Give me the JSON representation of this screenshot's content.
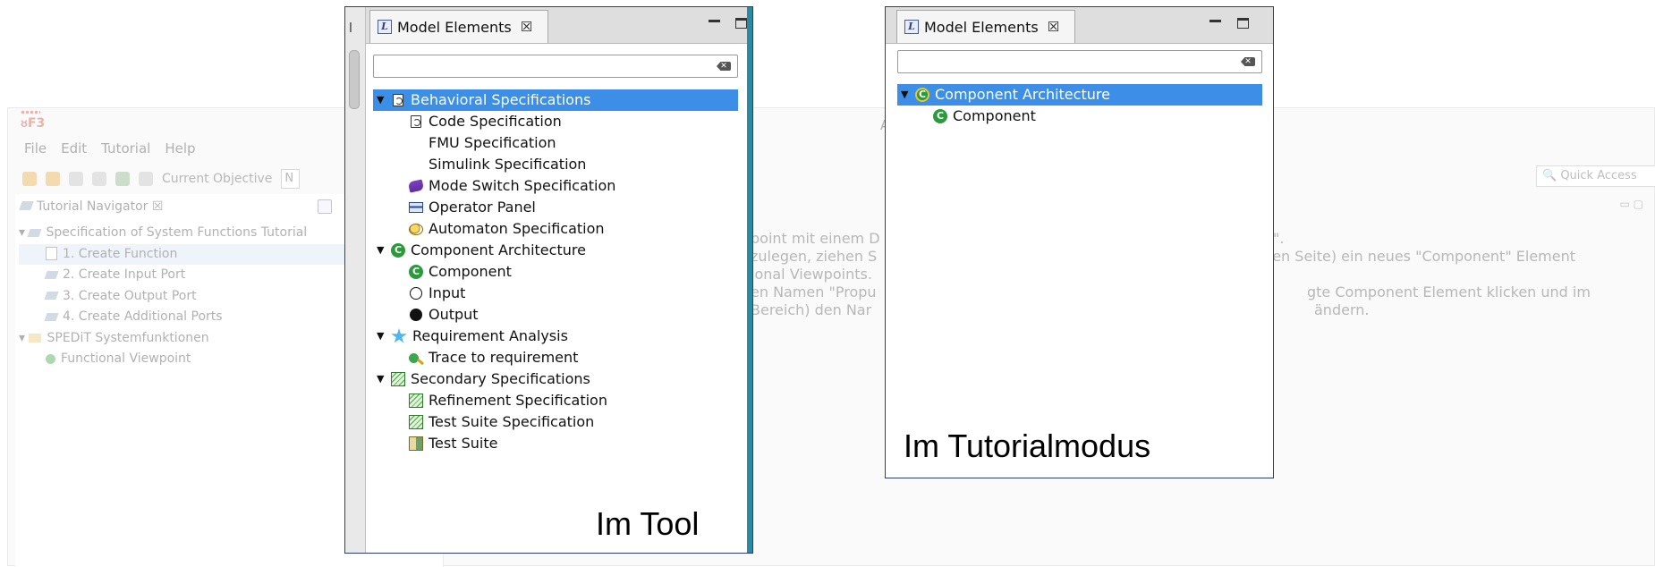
{
  "background_ide": {
    "app_logo": "ᴕF3",
    "window_title": "A",
    "menu": [
      "File",
      "Edit",
      "Tutorial",
      "Help"
    ],
    "current_objective_label": "Current Objective",
    "current_objective_value": "N",
    "quick_access_placeholder": "Quick Access",
    "navigator": {
      "tab_label": "Tutorial Navigator",
      "items": [
        {
          "label": "Specification of System Functions Tutorial",
          "level": 0
        },
        {
          "label": "1. Create Function",
          "level": 1,
          "selected": true
        },
        {
          "label": "2. Create Input Port",
          "level": 1
        },
        {
          "label": "3. Create Output Port",
          "level": 1
        },
        {
          "label": "4. Create Additional Ports",
          "level": 1
        },
        {
          "label": "SPEDiT Systemfunktionen",
          "level": 0
        },
        {
          "label": "Functional Viewpoint",
          "level": 1
        }
      ]
    },
    "instruction_fragments": [
      "point mit einem D",
      "zulegen, ziehen S",
      "ional Viewpoints.",
      "en Namen \"Propu",
      "Bereich) den Nar"
    ],
    "instruction_fragments_right": [
      "\".",
      "chten Seite) ein neues \"Component\" Element",
      "",
      "gte Component Element klicken und im",
      "ändern."
    ]
  },
  "panel_tool": {
    "tab_label": "Model Elements",
    "tab_close": "☒",
    "caption": "Im Tool",
    "tree": [
      {
        "label": "Behavioral Specifications",
        "icon": "code-spec-icon",
        "level": 0,
        "expanded": true,
        "selected": true
      },
      {
        "label": "Code Specification",
        "icon": "code-spec-icon",
        "level": 1
      },
      {
        "label": "FMU Specification",
        "icon": "none",
        "level": 1
      },
      {
        "label": "Simulink Specification",
        "icon": "none",
        "level": 1
      },
      {
        "label": "Mode Switch Specification",
        "icon": "mode-switch-icon",
        "level": 1
      },
      {
        "label": "Operator Panel",
        "icon": "operator-panel-icon",
        "level": 1
      },
      {
        "label": "Automaton Specification",
        "icon": "automaton-icon",
        "level": 1
      },
      {
        "label": "Component Architecture",
        "icon": "component-icon",
        "level": 0,
        "expanded": true
      },
      {
        "label": "Component",
        "icon": "component-icon",
        "level": 1
      },
      {
        "label": "Input",
        "icon": "input-port-icon",
        "level": 1
      },
      {
        "label": "Output",
        "icon": "output-port-icon",
        "level": 1
      },
      {
        "label": "Requirement Analysis",
        "icon": "star-icon",
        "level": 0,
        "expanded": true
      },
      {
        "label": "Trace to requirement",
        "icon": "trace-icon",
        "level": 1
      },
      {
        "label": "Secondary Specifications",
        "icon": "secondary-spec-icon",
        "level": 0,
        "expanded": true
      },
      {
        "label": "Refinement Specification",
        "icon": "secondary-spec-icon",
        "level": 1
      },
      {
        "label": "Test Suite Specification",
        "icon": "secondary-spec-icon",
        "level": 1
      },
      {
        "label": "Test Suite",
        "icon": "test-suite-icon",
        "level": 1
      }
    ]
  },
  "panel_tutorial": {
    "tab_label": "Model Elements",
    "tab_close": "☒",
    "caption": "Im Tutorialmodus",
    "tree": [
      {
        "label": "Component Architecture",
        "icon": "component-icon",
        "level": 0,
        "expanded": true,
        "selected": true
      },
      {
        "label": "Component",
        "icon": "component-icon",
        "level": 1
      }
    ]
  }
}
